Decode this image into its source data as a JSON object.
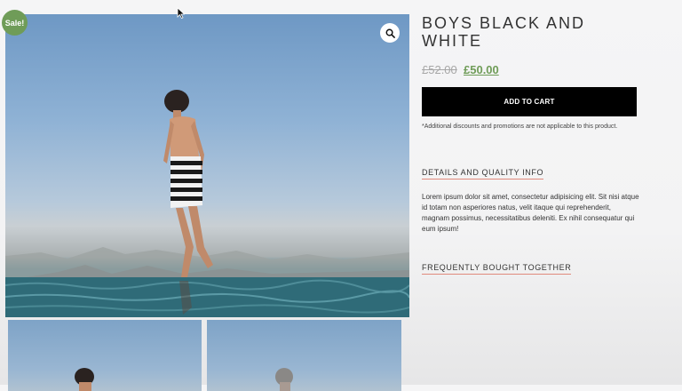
{
  "product": {
    "sale_badge": "Sale!",
    "title": "BOYS BLACK AND WHITE",
    "price_old": "£52.00",
    "price_new": "£50.00",
    "add_to_cart_label": "ADD TO CART",
    "disclaimer": "*Additional discounts and promotions are not applicable to this product.",
    "details_heading": "DETAILS AND QUALITY INFO",
    "details_text": "Lorem ipsum dolor sit amet, consectetur adipisicing elit. Sit nisi atque id totam non asperiores natus, velit itaque qui reprehenderit, magnam possimus, necessitatibus deleniti. Ex nihil consequatur qui eum ipsum!",
    "fbt_heading": "FREQUENTLY BOUGHT TOGETHER"
  },
  "icons": {
    "zoom": "magnifier-icon",
    "cursor": "mouse-pointer-icon"
  },
  "colors": {
    "sale_badge": "#6f9c58",
    "price_new": "#6f9c58",
    "button": "#000000",
    "heading_underline": "#e08a7d"
  }
}
